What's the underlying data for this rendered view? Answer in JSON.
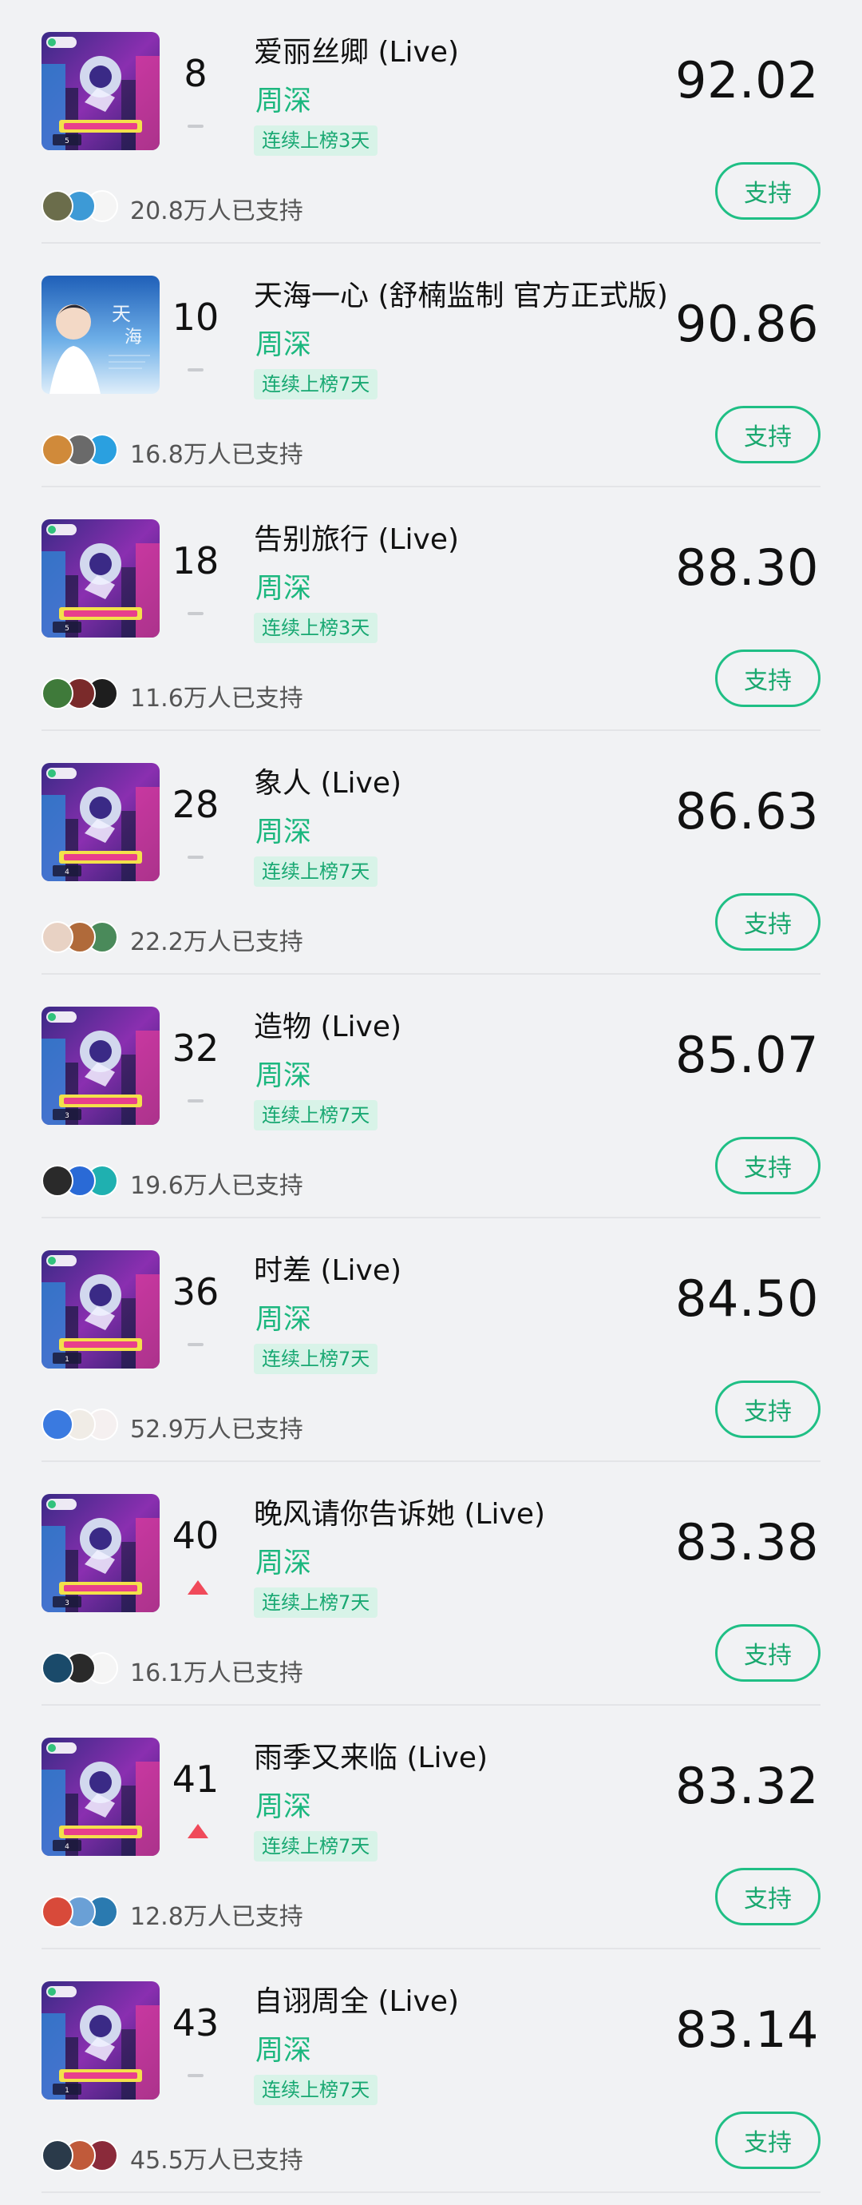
{
  "colors": {
    "background": "#f1f2f4",
    "accent_green": "#1bb77e",
    "badge_bg": "#d8f3e8",
    "trend_up": "#f04a5a",
    "trend_flat": "#c9cbcf"
  },
  "support_label": "支持",
  "rows": [
    {
      "rank": "8",
      "trend": "flat",
      "title": "爱丽丝卿 (Live)",
      "artist": "周深",
      "badge": "连续上榜3天",
      "score": "92.02",
      "supporters": "20.8万人已支持",
      "cover": "episode-5",
      "avatar_colors": [
        "#6b6d4b",
        "#3d9ad6",
        "#f5f5f5"
      ]
    },
    {
      "rank": "10",
      "trend": "flat",
      "title": "天海一心 (舒楠监制 官方正式版)",
      "artist": "周深",
      "badge": "连续上榜7天",
      "score": "90.86",
      "supporters": "16.8万人已支持",
      "cover": "tianhai",
      "avatar_colors": [
        "#d08a3a",
        "#6a6a6a",
        "#2aa0e0"
      ]
    },
    {
      "rank": "18",
      "trend": "flat",
      "title": "告别旅行 (Live)",
      "artist": "周深",
      "badge": "连续上榜3天",
      "score": "88.30",
      "supporters": "11.6万人已支持",
      "cover": "episode-5",
      "avatar_colors": [
        "#3f7a3a",
        "#7a2a2a",
        "#1e1e1e"
      ]
    },
    {
      "rank": "28",
      "trend": "flat",
      "title": "象人 (Live)",
      "artist": "周深",
      "badge": "连续上榜7天",
      "score": "86.63",
      "supporters": "22.2万人已支持",
      "cover": "episode-4",
      "avatar_colors": [
        "#e8d2c4",
        "#b06a3a",
        "#4a8a5a"
      ]
    },
    {
      "rank": "32",
      "trend": "flat",
      "title": "造物 (Live)",
      "artist": "周深",
      "badge": "连续上榜7天",
      "score": "85.07",
      "supporters": "19.6万人已支持",
      "cover": "episode-3",
      "avatar_colors": [
        "#2a2a2a",
        "#2a6ad6",
        "#1fb0b0"
      ]
    },
    {
      "rank": "36",
      "trend": "flat",
      "title": "时差 (Live)",
      "artist": "周深",
      "badge": "连续上榜7天",
      "score": "84.50",
      "supporters": "52.9万人已支持",
      "cover": "episode-1",
      "avatar_colors": [
        "#3a7ae0",
        "#f0ece6",
        "#f5f0f0"
      ]
    },
    {
      "rank": "40",
      "trend": "up",
      "title": "晚风请你告诉她 (Live)",
      "artist": "周深",
      "badge": "连续上榜7天",
      "score": "83.38",
      "supporters": "16.1万人已支持",
      "cover": "episode-3",
      "avatar_colors": [
        "#1a4a6a",
        "#2a2a2a",
        "#f5f5f5"
      ]
    },
    {
      "rank": "41",
      "trend": "up",
      "title": "雨季又来临 (Live)",
      "artist": "周深",
      "badge": "连续上榜7天",
      "score": "83.32",
      "supporters": "12.8万人已支持",
      "cover": "episode-4",
      "avatar_colors": [
        "#d84a3a",
        "#6aa0d6",
        "#2a7ab0"
      ]
    },
    {
      "rank": "43",
      "trend": "flat",
      "title": "自诩周全 (Live)",
      "artist": "周深",
      "badge": "连续上榜7天",
      "score": "83.14",
      "supporters": "45.5万人已支持",
      "cover": "episode-1",
      "avatar_colors": [
        "#2a3a4a",
        "#c05a3a",
        "#8a2a3a"
      ]
    }
  ]
}
